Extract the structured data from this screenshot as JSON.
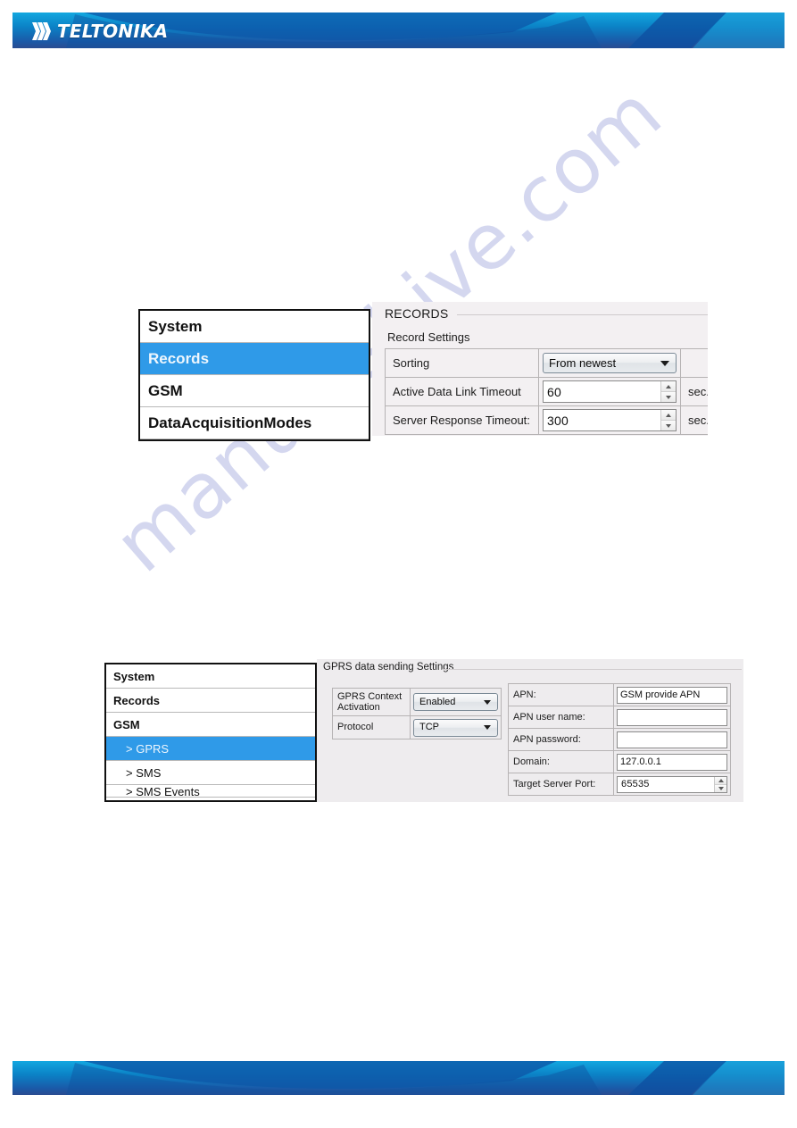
{
  "page": {
    "brand": "TELTONIKA",
    "logo_icon": "teltonika-chevrons-logo",
    "watermark": "manualshive.com",
    "accent_blue": "#2f9ae8",
    "banner_gradient_from": "#0fa3dc",
    "banner_gradient_to": "#274b8e"
  },
  "records_screenshot": {
    "nav": {
      "items": [
        {
          "label": "System",
          "selected": false
        },
        {
          "label": "Records",
          "selected": true
        },
        {
          "label": "GSM",
          "selected": false
        },
        {
          "label": "DataAcquisitionModes",
          "selected": false
        }
      ]
    },
    "pane": {
      "title": "RECORDS",
      "group_label": "Record Settings",
      "rows": [
        {
          "label": "Sorting",
          "control": "dropdown",
          "value": "From newest",
          "unit": "",
          "caret_icon": "chevron-down-icon"
        },
        {
          "label": "Active Data Link Timeout",
          "control": "spinner",
          "value": "60",
          "unit": "sec.",
          "up_icon": "spinner-up-icon",
          "down_icon": "spinner-down-icon"
        },
        {
          "label": "Server Response Timeout:",
          "control": "spinner",
          "value": "300",
          "unit": "sec.",
          "up_icon": "spinner-up-icon",
          "down_icon": "spinner-down-icon"
        }
      ]
    }
  },
  "gprs_screenshot": {
    "nav": {
      "items": [
        {
          "label": "System",
          "level": 0,
          "selected": false,
          "clipped": false
        },
        {
          "label": "Records",
          "level": 0,
          "selected": false,
          "clipped": false
        },
        {
          "label": "GSM",
          "level": 0,
          "selected": false,
          "clipped": false
        },
        {
          "label": "> GPRS",
          "level": 1,
          "selected": true,
          "clipped": false
        },
        {
          "label": "> SMS",
          "level": 1,
          "selected": false,
          "clipped": false
        },
        {
          "label": "> SMS Events",
          "level": 1,
          "selected": false,
          "clipped": true
        }
      ]
    },
    "pane": {
      "title": "GPRS  data sending Settings",
      "left_rows": [
        {
          "label": "GPRS Context Activation",
          "control": "dropdown",
          "value": "Enabled",
          "caret_icon": "chevron-down-icon"
        },
        {
          "label": "Protocol",
          "control": "dropdown",
          "value": "TCP",
          "caret_icon": "chevron-down-icon"
        }
      ],
      "right_rows": [
        {
          "label": "APN:",
          "control": "text",
          "value": "GSM provide APN"
        },
        {
          "label": "APN user name:",
          "control": "text",
          "value": ""
        },
        {
          "label": "APN password:",
          "control": "text",
          "value": ""
        },
        {
          "label": "Domain:",
          "control": "text",
          "value": "127.0.0.1"
        },
        {
          "label": "Target Server Port:",
          "control": "spinner",
          "value": "65535",
          "up_icon": "spinner-up-icon",
          "down_icon": "spinner-down-icon"
        }
      ]
    }
  }
}
